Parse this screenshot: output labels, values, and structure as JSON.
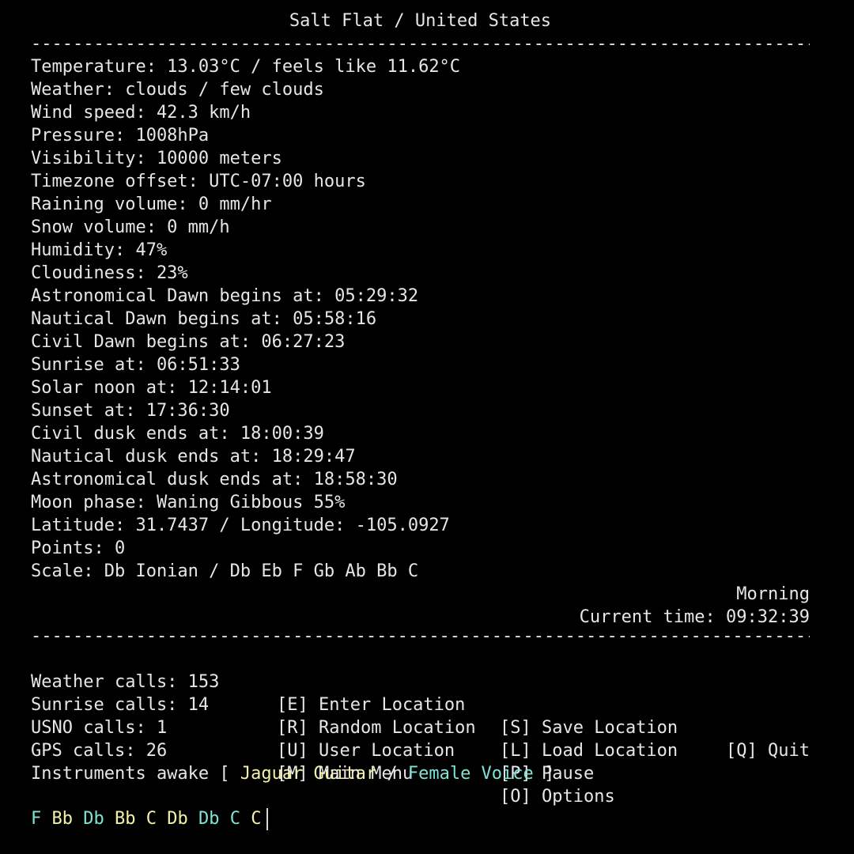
{
  "header": {
    "title": "Salt Flat / United States",
    "separator": "--------------------------------------------------------------------------------------------"
  },
  "weather": [
    "Temperature: 13.03°C / feels like 11.62°C",
    "Weather: clouds / few clouds",
    "Wind speed: 42.3 km/h",
    "Pressure: 1008hPa",
    "Visibility: 10000 meters",
    "Timezone offset: UTC-07:00 hours",
    "Raining volume: 0 mm/hr",
    "Snow volume: 0 mm/h",
    "Humidity: 47%",
    "Cloudiness: 23%",
    "Astronomical Dawn begins at: 05:29:32",
    "Nautical Dawn begins at: 05:58:16",
    "Civil Dawn begins at: 06:27:23",
    "Sunrise at: 06:51:33",
    "Solar noon at: 12:14:01",
    "Sunset at: 17:36:30",
    "Civil dusk ends at: 18:00:39",
    "Nautical dusk ends at: 18:29:47",
    "Astronomical dusk ends at: 18:58:30",
    "Moon phase: Waning Gibbous 55%",
    "Latitude: 31.7437 / Longitude: -105.0927",
    "Points: 0",
    "Scale: Db Ionian / Db Eb F Gb Ab Bb C"
  ],
  "status": {
    "period": "Morning",
    "current_time": "Current time: 09:32:39"
  },
  "stats": {
    "weather_calls": "Weather calls: 153",
    "sunrise_calls": "Sunrise calls: 14",
    "usno_calls": "USNO calls: 1",
    "gps_calls": "GPS calls: 26"
  },
  "menu": {
    "enter_location": "[E] Enter Location",
    "random_location": "[R] Random Location",
    "user_location": "[U] User Location",
    "main_menu": "[M] Main Menu",
    "save_location": "[S] Save Location",
    "load_location": "[L] Load Location",
    "pause": "[P] Pause",
    "options": "[O] Options",
    "quit": "[Q] Quit"
  },
  "instruments": {
    "prefix": "Instruments awake [ ",
    "instrument1": "Jaguar Guitar",
    "divider": " / ",
    "instrument2": "Female Voice",
    "suffix": " ]"
  },
  "notes": [
    {
      "text": "F",
      "color": "#7fe3d7"
    },
    {
      "text": "Bb",
      "color": "#f6f1a8"
    },
    {
      "text": "Db",
      "color": "#7fe3d7"
    },
    {
      "text": "Bb",
      "color": "#f6f1a8"
    },
    {
      "text": "C",
      "color": "#f6f1a8"
    },
    {
      "text": "Db",
      "color": "#f6f1a8"
    },
    {
      "text": "Db",
      "color": "#7fe3d7"
    },
    {
      "text": "C",
      "color": "#7fe3d7"
    },
    {
      "text": "C",
      "color": "#f6f1a8"
    }
  ]
}
